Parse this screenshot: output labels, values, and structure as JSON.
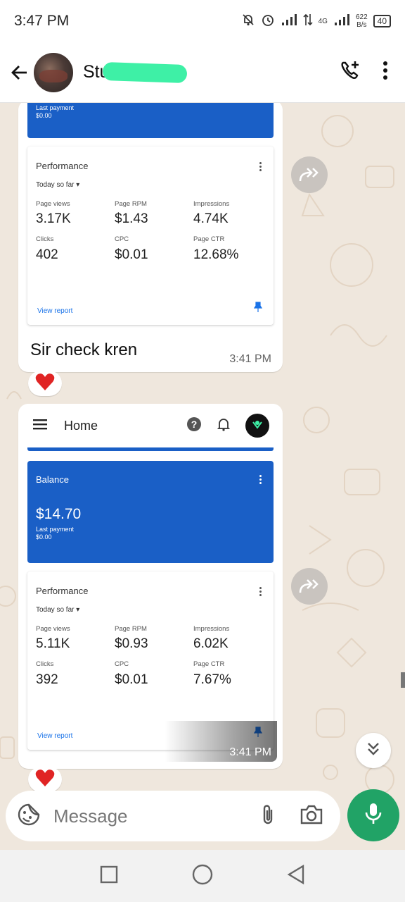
{
  "status_bar": {
    "time": "3:47 PM",
    "network": "4G",
    "speed_value": "622",
    "speed_unit": "B/s",
    "battery": "40"
  },
  "header": {
    "contact_name": "Stu"
  },
  "messages": [
    {
      "partial_card": {
        "last_payment_label": "Last payment",
        "last_payment_value": "$0.00"
      },
      "performance": {
        "title": "Performance",
        "range": "Today so far",
        "metrics": [
          {
            "label": "Page views",
            "value": "3.17K"
          },
          {
            "label": "Page RPM",
            "value": "$1.43"
          },
          {
            "label": "Impressions",
            "value": "4.74K"
          },
          {
            "label": "Clicks",
            "value": "402"
          },
          {
            "label": "CPC",
            "value": "$0.01"
          },
          {
            "label": "Page CTR",
            "value": "12.68%"
          }
        ],
        "view_report": "View report"
      },
      "text": "Sir check kren",
      "time": "3:41 PM",
      "reaction": "heart"
    },
    {
      "app_bar": {
        "title": "Home"
      },
      "balance": {
        "label": "Balance",
        "value": "$14.70",
        "last_payment_label": "Last payment",
        "last_payment_value": "$0.00"
      },
      "performance": {
        "title": "Performance",
        "range": "Today so far",
        "metrics": [
          {
            "label": "Page views",
            "value": "5.11K"
          },
          {
            "label": "Page RPM",
            "value": "$0.93"
          },
          {
            "label": "Impressions",
            "value": "6.02K"
          },
          {
            "label": "Clicks",
            "value": "392"
          },
          {
            "label": "CPC",
            "value": "$0.01"
          },
          {
            "label": "Page CTR",
            "value": "7.67%"
          }
        ],
        "view_report": "View report"
      },
      "time": "3:41 PM",
      "reaction": "heart"
    }
  ],
  "composer": {
    "placeholder": "Message"
  },
  "colors": {
    "accent_green": "#21a366",
    "adsense_blue": "#1a5fc6",
    "chat_background": "#efe7dd",
    "link_blue": "#1a73e8"
  }
}
